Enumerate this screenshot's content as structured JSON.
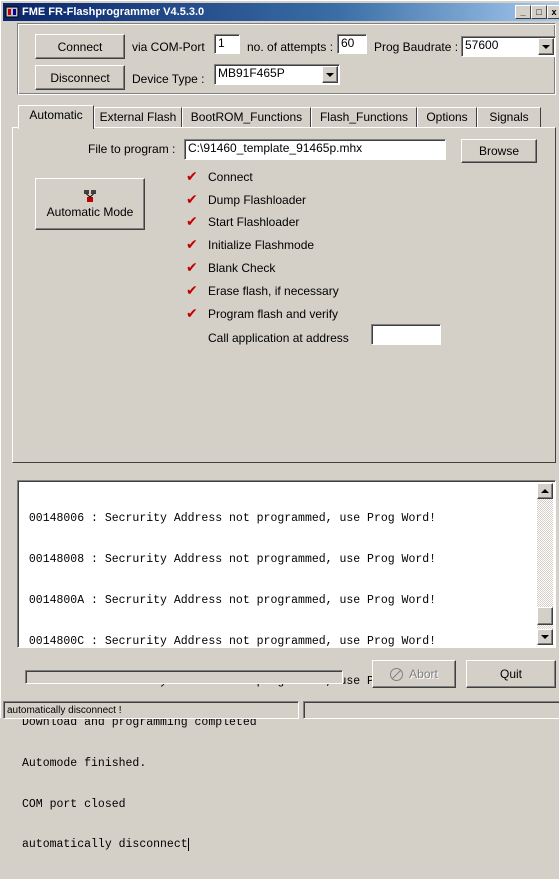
{
  "window": {
    "title": "FME FR-Flashprogrammer V4.5.3.0",
    "min_glyph": "_",
    "max_glyph": "□",
    "close_glyph": "x"
  },
  "connection": {
    "connect_label": "Connect",
    "disconnect_label": "Disconnect",
    "via_com_port_label": "via COM-Port",
    "com_port_value": "1",
    "attempts_label": "no. of attempts :",
    "attempts_value": "60",
    "baudrate_label": "Prog Baudrate :",
    "baudrate_value": "57600",
    "device_type_label": "Device Type :",
    "device_type_value": "MB91F465P"
  },
  "tabs": [
    {
      "label": "Automatic",
      "active": true
    },
    {
      "label": "External Flash"
    },
    {
      "label": "BootROM_Functions"
    },
    {
      "label": "Flash_Functions"
    },
    {
      "label": "Options"
    },
    {
      "label": "Signals"
    }
  ],
  "automatic": {
    "file_label": "File to program :",
    "file_value": "C:\\91460_template_91465p.mhx",
    "browse_label": "Browse",
    "automatic_mode_label": "Automatic Mode",
    "automatic_mode_icon": "network-icon",
    "checkmark_color": "#c00000",
    "steps": [
      "Connect",
      "Dump Flashloader",
      "Start Flashloader",
      "Initialize Flashmode",
      "Blank Check",
      "Erase flash, if necessary",
      "Program flash and verify"
    ],
    "call_app_label": "Call application at address",
    "call_app_value": ""
  },
  "log": {
    "lines": [
      " 00148006 : Secrurity Address not programmed, use Prog Word!",
      " 00148008 : Secrurity Address not programmed, use Prog Word!",
      " 0014800A : Secrurity Address not programmed, use Prog Word!",
      " 0014800C : Secrurity Address not programmed, use Prog Word!",
      " 0014800E : Secrurity Address not programmed, use Prog Word!",
      "Download and programming completed",
      "Automode finished.",
      "COM port closed",
      "automatically disconnect"
    ]
  },
  "footer": {
    "abort_label": "Abort",
    "quit_label": "Quit",
    "progress": 0
  },
  "status": {
    "text": "automatically disconnect !",
    "panel2": ""
  },
  "colors": {
    "title_start": "#0a246a",
    "title_end": "#a6caf0",
    "face": "#d4d0c8"
  }
}
